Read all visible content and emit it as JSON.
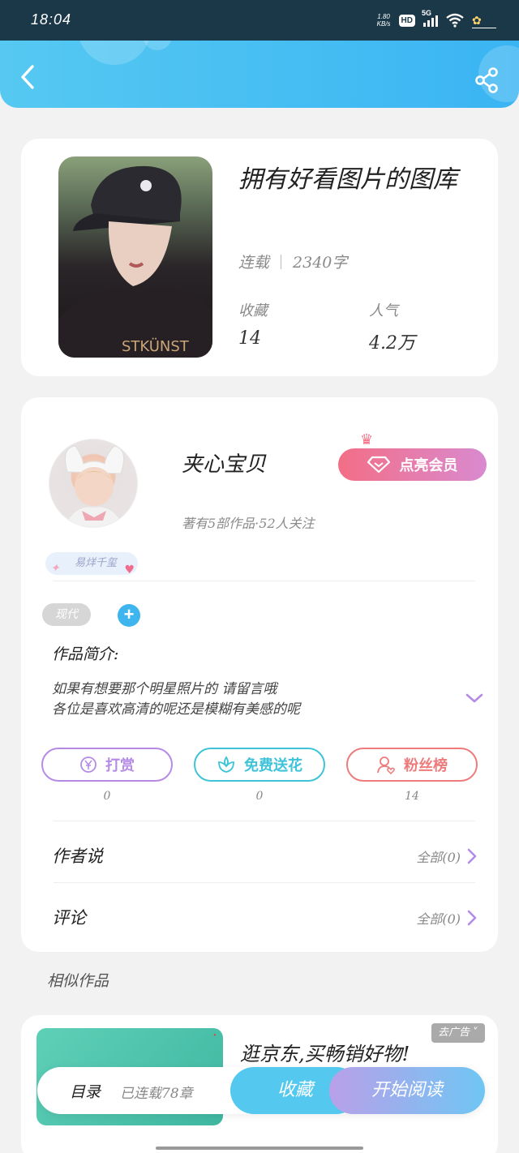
{
  "status_bar": {
    "time": "18:04",
    "net_speed_value": "1.80",
    "net_speed_unit": "KB/s",
    "hd_badge": "HD",
    "network": "5G",
    "icons": [
      "wifi-icon",
      "signal-icon",
      "flower-icon"
    ]
  },
  "header": {
    "icons": [
      "back-arrow-icon",
      "share-icon"
    ]
  },
  "book": {
    "title": "拥有好看图片的图库",
    "status": "连载",
    "word_count": "2340字",
    "favorites_label": "收藏",
    "favorites_value": "14",
    "popularity_label": "人气",
    "popularity_value": "4.2万"
  },
  "author": {
    "name": "夹心宝贝",
    "subtitle": "著有5部作品·52人关注",
    "vip_button": "点亮会员",
    "fan_tag": "易烊千玺"
  },
  "work": {
    "genre": "现代",
    "intro_title": "作品简介:",
    "intro_lines": [
      "如果有想要那个明星照片的 请留言哦",
      "各位是喜欢高清的呢还是模糊有美感的呢"
    ]
  },
  "actions": [
    {
      "label": "打赏",
      "count": "0",
      "icon": "yen-coin-icon",
      "color": "#b58be6"
    },
    {
      "label": "免费送花",
      "count": "0",
      "icon": "flower-outline-icon",
      "color": "#3ec3d8"
    },
    {
      "label": "粉丝榜",
      "count": "14",
      "icon": "fan-user-icon",
      "color": "#ee7b7b"
    }
  ],
  "sections": {
    "author_says": {
      "title": "作者说",
      "link": "全部(0)"
    },
    "comments": {
      "title": "评论",
      "link": "全部(0)"
    }
  },
  "similar": {
    "title": "相似作品",
    "ad_title": "逛京东,买畅销好物!",
    "ad_tag": "去广告"
  },
  "bottom_bar": {
    "toc_label": "目录",
    "toc_sub": "已连载78章",
    "favorite_button": "收藏",
    "read_button": "开始阅读"
  }
}
